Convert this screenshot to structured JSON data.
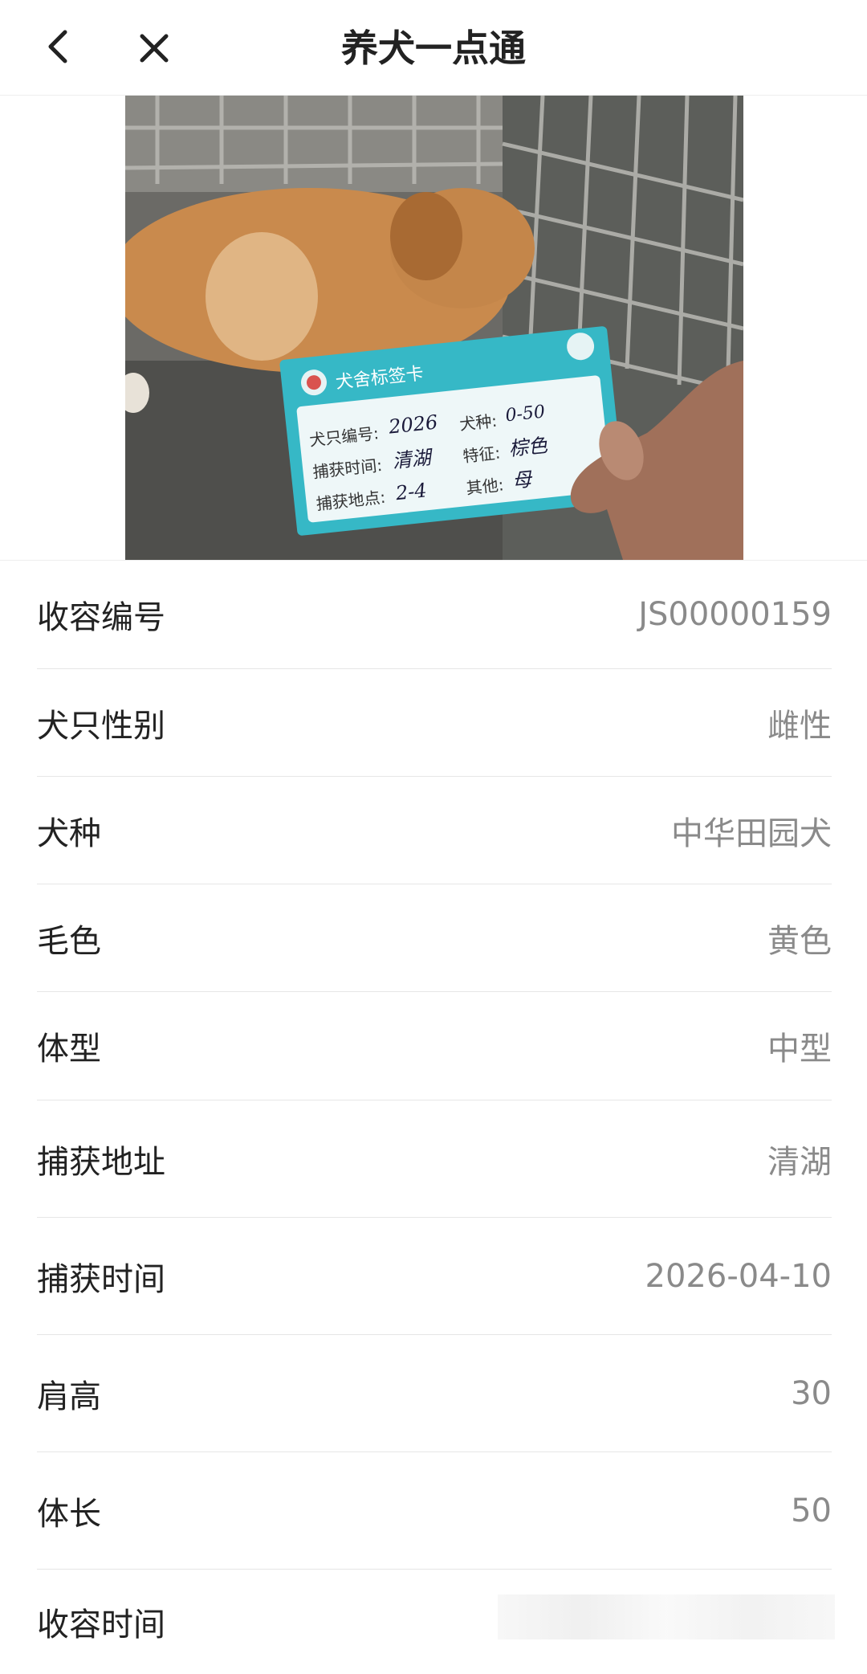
{
  "header": {
    "title": "养犬一点通",
    "back_icon": "chevron-left-icon",
    "close_icon": "close-icon"
  },
  "photo": {
    "card_title": "犬舍标签卡",
    "card_fields": [
      {
        "label": "犬只编号:",
        "value": "2026"
      },
      {
        "label": "犬种:",
        "value": "0-50"
      },
      {
        "label": "捕获时间:",
        "value": "清湖"
      },
      {
        "label": "特征:",
        "value": "棕色"
      },
      {
        "label": "捕获地点:",
        "value": "2-4"
      },
      {
        "label": "其他:",
        "value": "母"
      }
    ]
  },
  "details": [
    {
      "label": "收容编号",
      "value": "JS00000159"
    },
    {
      "label": "犬只性别",
      "value": "雌性"
    },
    {
      "label": "犬种",
      "value": "中华田园犬"
    },
    {
      "label": "毛色",
      "value": "黄色"
    },
    {
      "label": "体型",
      "value": "中型"
    },
    {
      "label": "捕获地址",
      "value": "清湖"
    },
    {
      "label": "捕获时间",
      "value": "2026-04-10"
    },
    {
      "label": "肩高",
      "value": "30"
    },
    {
      "label": "体长",
      "value": "50"
    },
    {
      "label": "收容时间",
      "value": ""
    }
  ]
}
